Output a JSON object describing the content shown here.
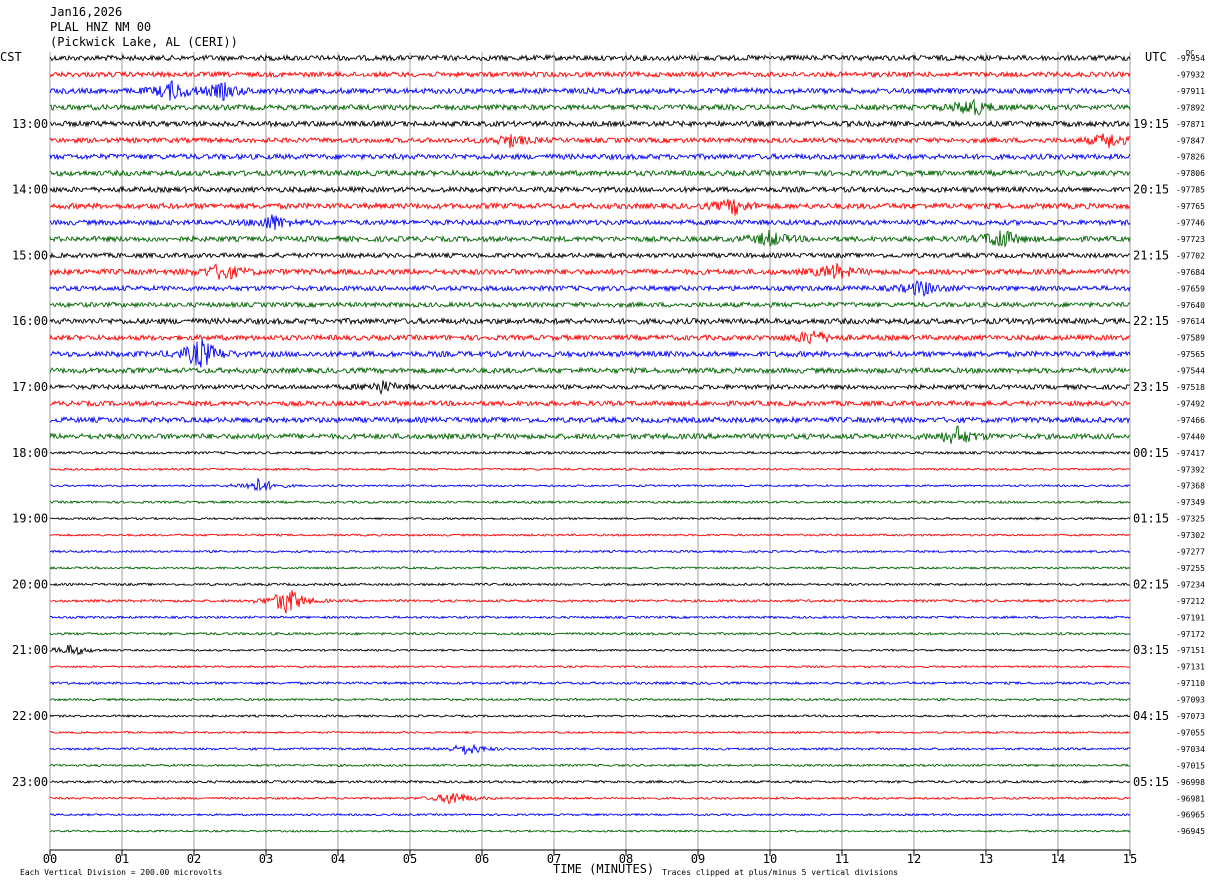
{
  "header": {
    "date": "Jan16,2026",
    "station": "PLAL HNZ NM 00",
    "location": "(Pickwick Lake, AL (CERI))"
  },
  "chart_data": {
    "type": "helicorder",
    "left_axis_label": "CST",
    "right_axis_label": "UTC",
    "right_axis_corner": "DC",
    "xlabel": "TIME (MINUTES)",
    "x_ticks": [
      "00",
      "01",
      "02",
      "03",
      "04",
      "05",
      "06",
      "07",
      "08",
      "09",
      "10",
      "11",
      "12",
      "13",
      "14",
      "15"
    ],
    "xlim": [
      0,
      15
    ],
    "cst_labels": [
      "13:00",
      "14:00",
      "15:00",
      "16:00",
      "17:00",
      "18:00",
      "19:00",
      "20:00",
      "21:00",
      "22:00",
      "23:00"
    ],
    "utc_labels": [
      "19:15",
      "20:15",
      "21:15",
      "22:15",
      "23:15",
      "00:15",
      "01:15",
      "02:15",
      "03:15",
      "04:15",
      "05:15"
    ],
    "dc_offsets": [
      "-97954",
      "-97932",
      "-97911",
      "-97892",
      "-97871",
      "-97847",
      "-97826",
      "-97806",
      "-97785",
      "-97765",
      "-97746",
      "-97723",
      "-97702",
      "-97684",
      "-97659",
      "-97640",
      "-97614",
      "-97589",
      "-97565",
      "-97544",
      "-97518",
      "-97492",
      "-97466",
      "-97440",
      "-97417",
      "-97392",
      "-97368",
      "-97349",
      "-97325",
      "-97302",
      "-97277",
      "-97255",
      "-97234",
      "-97212",
      "-97191",
      "-97172",
      "-97151",
      "-97131",
      "-97110",
      "-97093",
      "-97073",
      "-97055",
      "-97034",
      "-97015",
      "-96998",
      "-96981",
      "-96965",
      "-96945"
    ],
    "trace_colors": [
      "#000000",
      "#ff0000",
      "#0000ff",
      "#006400"
    ],
    "footer_left": "Each Vertical Division =  200.00 microvolts",
    "footer_right": "Traces clipped at plus/minus 5 vertical divisions",
    "events": [
      {
        "trace": 2,
        "minute": 1.7,
        "amplitude": 3
      },
      {
        "trace": 2,
        "minute": 2.4,
        "amplitude": 2.5
      },
      {
        "trace": 3,
        "minute": 12.8,
        "amplitude": 3
      },
      {
        "trace": 5,
        "minute": 6.4,
        "amplitude": 2
      },
      {
        "trace": 5,
        "minute": 14.7,
        "amplitude": 2.5
      },
      {
        "trace": 9,
        "minute": 9.5,
        "amplitude": 2.5
      },
      {
        "trace": 10,
        "minute": 3.1,
        "amplitude": 2.5
      },
      {
        "trace": 11,
        "minute": 10.0,
        "amplitude": 2.5
      },
      {
        "trace": 11,
        "minute": 13.2,
        "amplitude": 3.5
      },
      {
        "trace": 13,
        "minute": 2.4,
        "amplitude": 3
      },
      {
        "trace": 13,
        "minute": 10.9,
        "amplitude": 2.5
      },
      {
        "trace": 14,
        "minute": 12.1,
        "amplitude": 2.5
      },
      {
        "trace": 17,
        "minute": 10.6,
        "amplitude": 2.5
      },
      {
        "trace": 18,
        "minute": 2.1,
        "amplitude": 5
      },
      {
        "trace": 20,
        "minute": 4.6,
        "amplitude": 2
      },
      {
        "trace": 23,
        "minute": 12.6,
        "amplitude": 3
      },
      {
        "trace": 26,
        "minute": 2.9,
        "amplitude": 2.5
      },
      {
        "trace": 33,
        "minute": 3.3,
        "amplitude": 5
      },
      {
        "trace": 36,
        "minute": 0.3,
        "amplitude": 2
      },
      {
        "trace": 42,
        "minute": 5.8,
        "amplitude": 2
      },
      {
        "trace": 45,
        "minute": 5.6,
        "amplitude": 2.5
      }
    ]
  }
}
